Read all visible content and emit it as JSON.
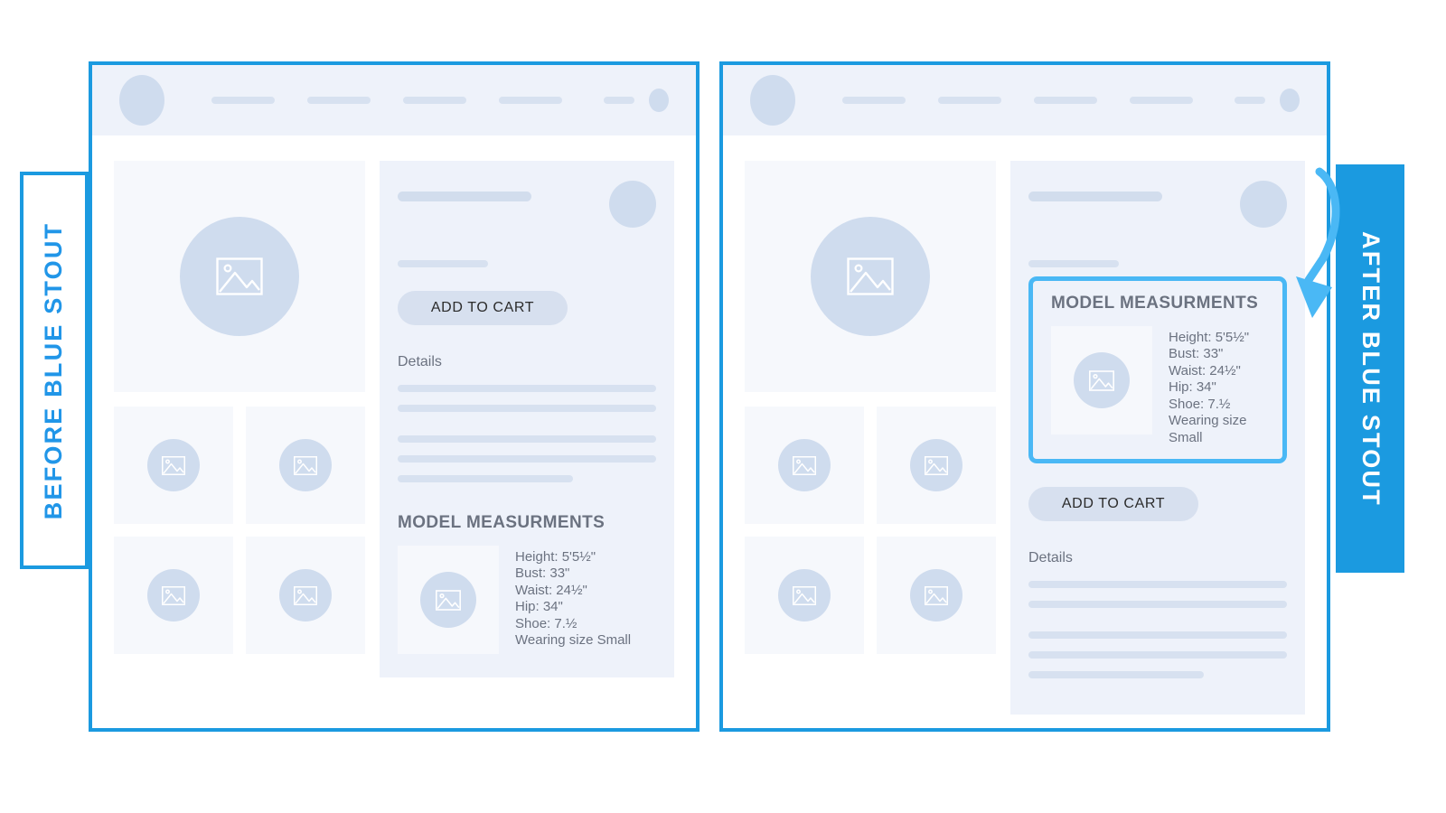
{
  "labels": {
    "before": "BEFORE  BLUE STOUT",
    "after": "AFTER  BLUE STOUT"
  },
  "colors": {
    "frame_blue": "#1b9ae0",
    "highlight_blue": "#4ab8f5",
    "badge_text_blue": "#2196e8",
    "panel_bg": "#eef2fa",
    "placeholder_fill": "#cfdcee",
    "skeleton_line": "#d7e1f0",
    "text_gray": "#6b7280"
  },
  "icons": {
    "image_placeholder": "image-placeholder-icon",
    "arrow": "curved-arrow-icon"
  },
  "before_window": {
    "add_to_cart_label": "ADD TO CART",
    "details_label": "Details",
    "measurements": {
      "title": "MODEL MEASURMENTS",
      "lines": [
        "Height: 5'5½\"",
        "Bust: 33\"",
        "Waist: 24½\"",
        "Hip: 34\"",
        "Shoe: 7.½",
        "Wearing size Small"
      ]
    }
  },
  "after_window": {
    "add_to_cart_label": "ADD TO CART",
    "details_label": "Details",
    "measurements": {
      "title": "MODEL MEASURMENTS",
      "lines": [
        "Height: 5'5½\"",
        "Bust: 33\"",
        "Waist: 24½\"",
        "Hip: 34\"",
        "Shoe: 7.½",
        "Wearing size Small"
      ]
    }
  }
}
